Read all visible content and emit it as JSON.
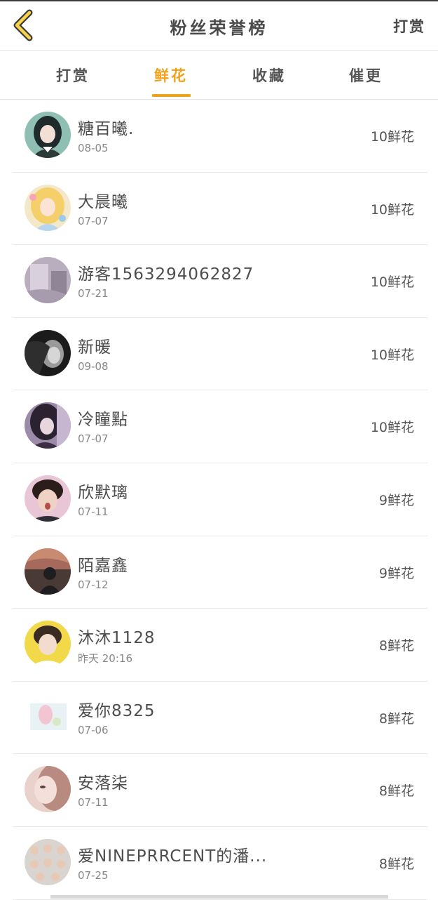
{
  "header": {
    "title": "粉丝荣誉榜",
    "reward_label": "打赏"
  },
  "tabs": [
    {
      "label": "打赏",
      "active": false
    },
    {
      "label": "鲜花",
      "active": true
    },
    {
      "label": "收藏",
      "active": false
    },
    {
      "label": "催更",
      "active": false
    }
  ],
  "colors": {
    "accent": "#f0a21c",
    "text": "#4d4d4d",
    "divider": "#e8e8e8",
    "back_arrow_fill": "#f7d24a"
  },
  "rows": [
    {
      "name": "糖百曦.",
      "date": "08-05",
      "flowers": "10鲜花"
    },
    {
      "name": "大晨曦",
      "date": "07-07",
      "flowers": "10鲜花"
    },
    {
      "name": "游客1563294062827",
      "date": "07-21",
      "flowers": "10鲜花"
    },
    {
      "name": "新暖",
      "date": "09-08",
      "flowers": "10鲜花"
    },
    {
      "name": "冷瞳點",
      "date": "07-07",
      "flowers": "10鲜花"
    },
    {
      "name": "欣默璃",
      "date": "07-11",
      "flowers": "9鲜花"
    },
    {
      "name": "陌嘉鑫",
      "date": "07-12",
      "flowers": "9鲜花"
    },
    {
      "name": "沐沐1128",
      "date": "昨天 20:16",
      "flowers": "8鲜花"
    },
    {
      "name": "爱你8325",
      "date": "07-06",
      "flowers": "8鲜花"
    },
    {
      "name": "安落柒",
      "date": "07-11",
      "flowers": "8鲜花"
    },
    {
      "name": "爱NINEPRRCENT的潘...",
      "date": "07-25",
      "flowers": "8鲜花"
    }
  ]
}
